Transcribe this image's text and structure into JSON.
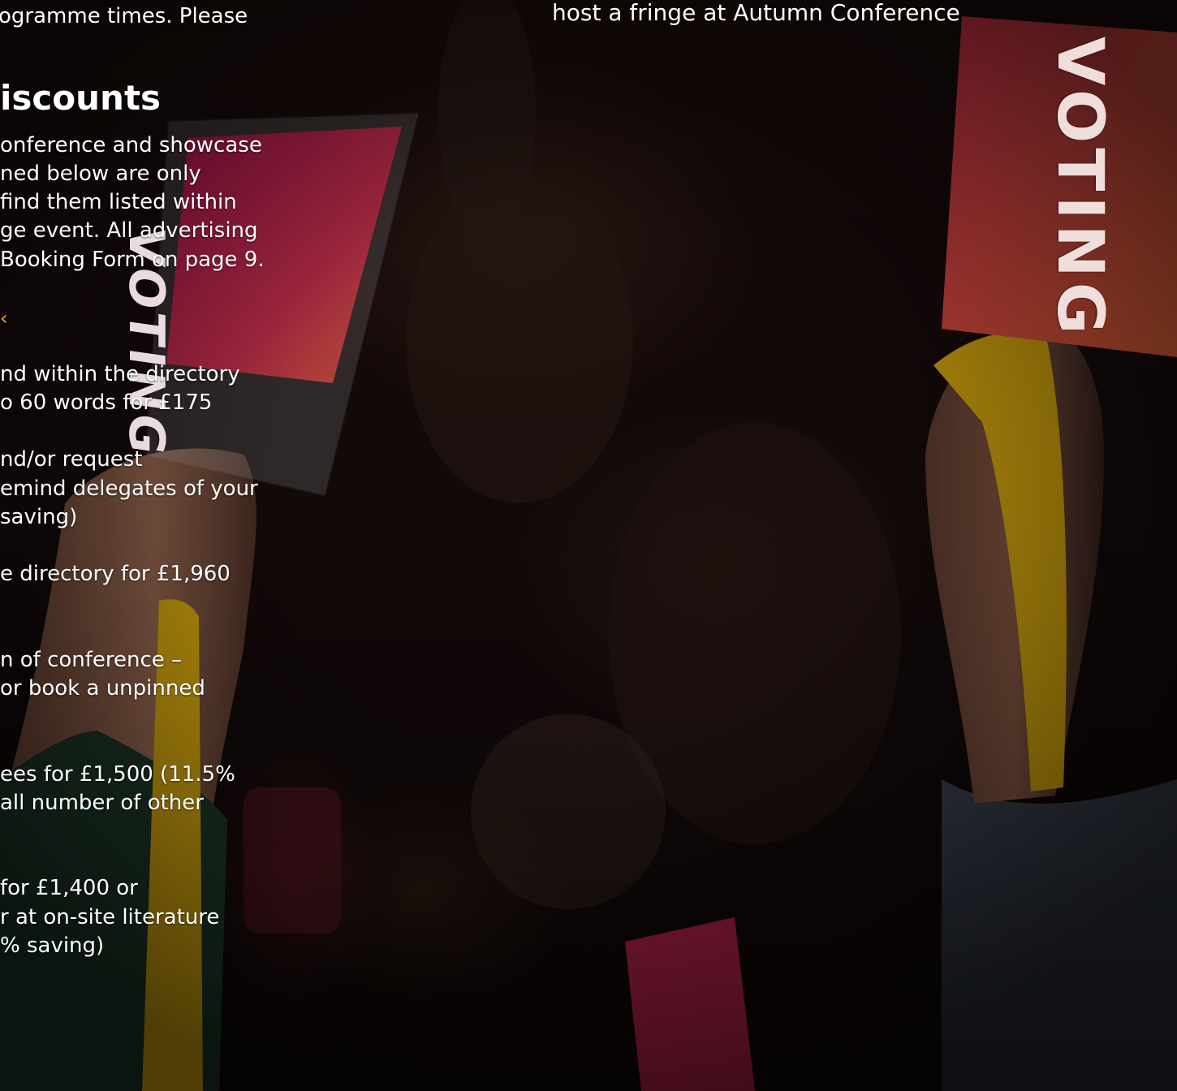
{
  "top_right_text": "host a fringe at Autumn Conference",
  "left_column": {
    "intro_fragment": "ogramme times. Please",
    "heading": "iscounts",
    "paragraph_lines": [
      "onference and showcase",
      "ned below are only",
      "find them listed within",
      "ge event. All advertising",
      "Booking Form on page 9."
    ],
    "accent_marker": "‹",
    "items": [
      {
        "lines": [
          "nd within the directory",
          "o 60 words for £175"
        ]
      },
      {
        "lines": [
          "nd/or request",
          "emind delegates of your",
          "saving)"
        ]
      },
      {
        "lines": [
          "e directory for £1,960"
        ]
      },
      {
        "lines": [
          "n of conference –",
          "or book a unpinned"
        ]
      },
      {
        "lines": [
          "ees for £1,500 (11.5%",
          "all number of other"
        ]
      },
      {
        "lines": [
          "for £1,400 or",
          "r at on-site literature",
          "% saving)"
        ]
      }
    ]
  },
  "photo": {
    "card_label_left": "VOTING",
    "card_label_right": "VOTING",
    "colors": {
      "card_pink": "#c2185b",
      "card_orange": "#e8563a",
      "lanyard_yellow": "#d8a90f",
      "skin": "#8a5a45",
      "sleeve_green": "#1f3a2a"
    }
  }
}
